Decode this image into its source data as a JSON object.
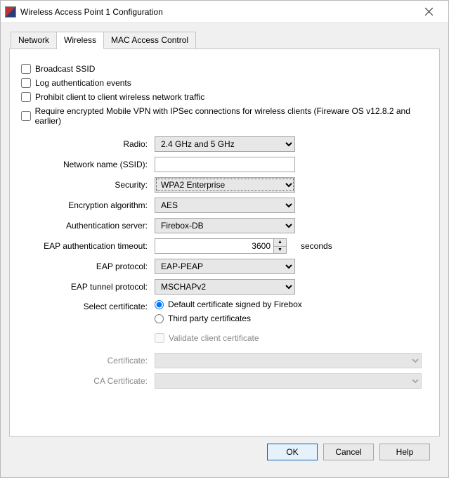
{
  "window": {
    "title": "Wireless Access Point 1 Configuration"
  },
  "tabs": [
    {
      "label": "Network",
      "active": false
    },
    {
      "label": "Wireless",
      "active": true
    },
    {
      "label": "MAC Access Control",
      "active": false
    }
  ],
  "checkboxes": {
    "broadcast_ssid": {
      "label": "Broadcast SSID",
      "checked": false
    },
    "log_auth": {
      "label": "Log authentication events",
      "checked": false
    },
    "prohibit_client": {
      "label": "Prohibit client to client wireless network traffic",
      "checked": false
    },
    "require_vpn": {
      "label": "Require encrypted Mobile VPN with IPSec connections for wireless clients (Fireware OS v12.8.2 and earlier)",
      "checked": false
    }
  },
  "fields": {
    "radio": {
      "label": "Radio:",
      "value": "2.4 GHz and 5 GHz"
    },
    "ssid": {
      "label": "Network name (SSID):",
      "value": ""
    },
    "security": {
      "label": "Security:",
      "value": "WPA2 Enterprise"
    },
    "encryption": {
      "label": "Encryption algorithm:",
      "value": "AES"
    },
    "auth_server": {
      "label": "Authentication server:",
      "value": "Firebox-DB"
    },
    "eap_timeout": {
      "label": "EAP authentication timeout:",
      "value": "3600",
      "unit": "seconds"
    },
    "eap_protocol": {
      "label": "EAP protocol:",
      "value": "EAP-PEAP"
    },
    "eap_tunnel": {
      "label": "EAP tunnel protocol:",
      "value": "MSCHAPv2"
    },
    "select_cert": {
      "label": "Select certificate:",
      "options": {
        "default": "Default certificate signed by Firebox",
        "third": "Third party certificates"
      },
      "selected": "default"
    },
    "validate_client": {
      "label": "Validate client certificate",
      "checked": false,
      "enabled": false
    },
    "certificate": {
      "label": "Certificate:",
      "value": "",
      "enabled": false
    },
    "ca_certificate": {
      "label": "CA Certificate:",
      "value": "",
      "enabled": false
    }
  },
  "buttons": {
    "ok": "OK",
    "cancel": "Cancel",
    "help": "Help"
  }
}
